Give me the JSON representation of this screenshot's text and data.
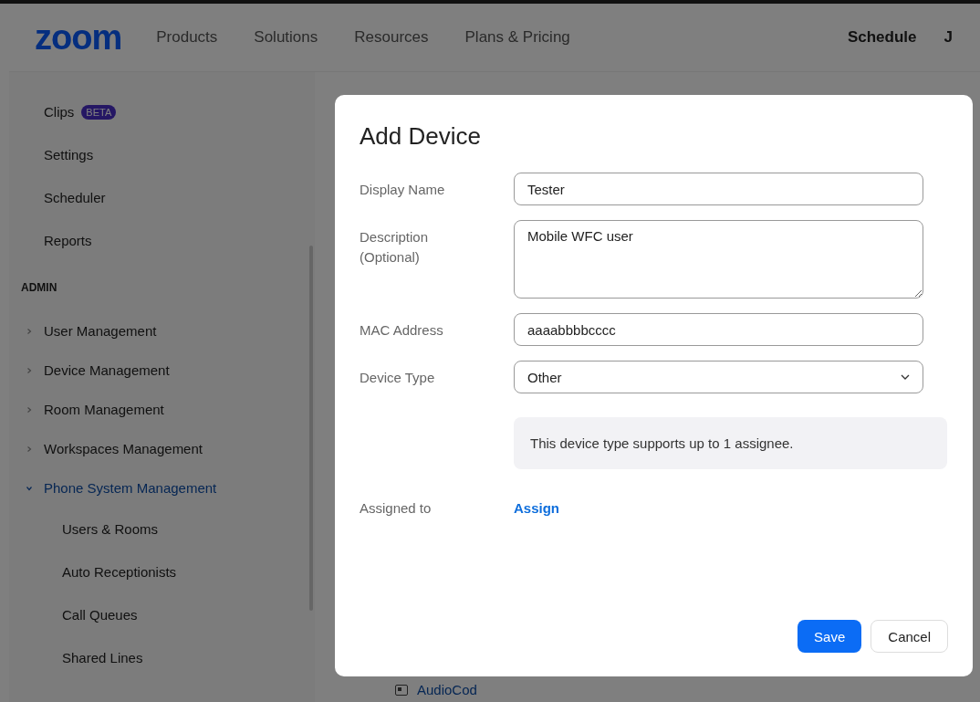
{
  "nav": {
    "logo": "zoom",
    "links": [
      "Products",
      "Solutions",
      "Resources",
      "Plans & Pricing"
    ],
    "right_links": [
      "Schedule",
      "J"
    ]
  },
  "sidebar": {
    "items": [
      {
        "kind": "link",
        "label": "Clips",
        "badge": "BETA"
      },
      {
        "kind": "link",
        "label": "Settings"
      },
      {
        "kind": "link",
        "label": "Scheduler"
      },
      {
        "kind": "link",
        "label": "Reports"
      },
      {
        "kind": "section",
        "label": "ADMIN"
      },
      {
        "kind": "group",
        "label": "User Management",
        "expanded": false
      },
      {
        "kind": "group",
        "label": "Device Management",
        "expanded": false
      },
      {
        "kind": "group",
        "label": "Room Management",
        "expanded": false
      },
      {
        "kind": "group",
        "label": "Workspaces Management",
        "expanded": false
      },
      {
        "kind": "group",
        "label": "Phone System Management",
        "expanded": true,
        "children": [
          {
            "label": "Users & Rooms"
          },
          {
            "label": "Auto Receptionists"
          },
          {
            "label": "Call Queues"
          },
          {
            "label": "Shared Lines"
          }
        ]
      }
    ]
  },
  "background": {
    "device_link": "AudioCod"
  },
  "dialog": {
    "title": "Add Device",
    "fields": [
      {
        "kind": "text",
        "label": "Display Name",
        "value": "Tester"
      },
      {
        "kind": "textarea",
        "label": "Description\n(Optional)",
        "value": "Mobile WFC user"
      },
      {
        "kind": "text",
        "label": "MAC Address",
        "value": "aaaabbbbcccc"
      },
      {
        "kind": "select",
        "label": "Device Type",
        "value": "Other"
      }
    ],
    "info": "This device type supports up to 1 assignee.",
    "assigned_to": {
      "label": "Assigned to",
      "link": "Assign"
    },
    "buttons": [
      {
        "kind": "primary",
        "label": "Save"
      },
      {
        "kind": "secondary",
        "label": "Cancel"
      }
    ]
  }
}
